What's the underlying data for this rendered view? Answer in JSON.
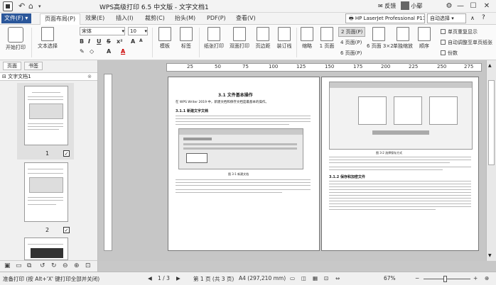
{
  "window": {
    "title": "WPS高级打印 6.5 中文版 - 文字文档1",
    "user_name": "反馈",
    "user_account": "小鄢"
  },
  "menu": {
    "file_label": "文件(F)",
    "tabs": [
      "页面布局(P)",
      "效果(E)",
      "插入(I)",
      "裁剪(C)",
      "抬头(M)",
      "PDF(P)",
      "查看(V)"
    ],
    "active_tab": 0,
    "printer": "HP LaserJet Professional P1108",
    "auto_select": "自动选择"
  },
  "ribbon": {
    "start_print": "开始打印",
    "text_select": "文本选择",
    "font_name": "宋体",
    "font_size": "10",
    "template": "模板",
    "watermark": "标签",
    "paper_print": "纸张打印",
    "duplex_print": "双面打印",
    "page_margin": "页边距",
    "binding_line": "装订线",
    "shrink": "缩略",
    "one_page": "1 页面",
    "layout_options": [
      "2 页面(P)",
      "4 页面(P)",
      "6 页面(P)",
      "6 页面 3×2"
    ],
    "selected_layout": "2 页面(P)",
    "single_scale": "单独缩放",
    "order": "顺序",
    "chk_repeat_header": "单页重复显示",
    "chk_auto_adjust": "自动调整至单页纸张",
    "chk_copies": "份数"
  },
  "sidebar": {
    "tabs": [
      "页面",
      "书签"
    ],
    "doc_name": "文字文档1",
    "thumbs": [
      {
        "num": "1",
        "checked": "✓"
      },
      {
        "num": "2",
        "checked": "✓"
      }
    ]
  },
  "ruler": {
    "labels": [
      "25",
      "50",
      "75",
      "100",
      "125",
      "150",
      "175",
      "200",
      "225",
      "250",
      "275"
    ]
  },
  "document": {
    "page1_title": "3.1    文件基本操作",
    "page1_intro": "在 WPS Writer 2019 中，新建文档和保存文档是最基本的操作。",
    "page1_section": "3.1.1  新建文字文档",
    "page1_caption": "图 3-1 新建文档",
    "page2_section": "3.1.2  保存和加密文件",
    "page2_caption": "图 3-2 选择保存方式"
  },
  "status": {
    "hint": "准备打印 (按 Alt+'X' 键打印全部并关闭)",
    "page_nav": "1 / 3",
    "page_count": "第 1 页 (共 3 页)",
    "paper_size": "A4 (297,210 mm)",
    "zoom": "67%"
  }
}
